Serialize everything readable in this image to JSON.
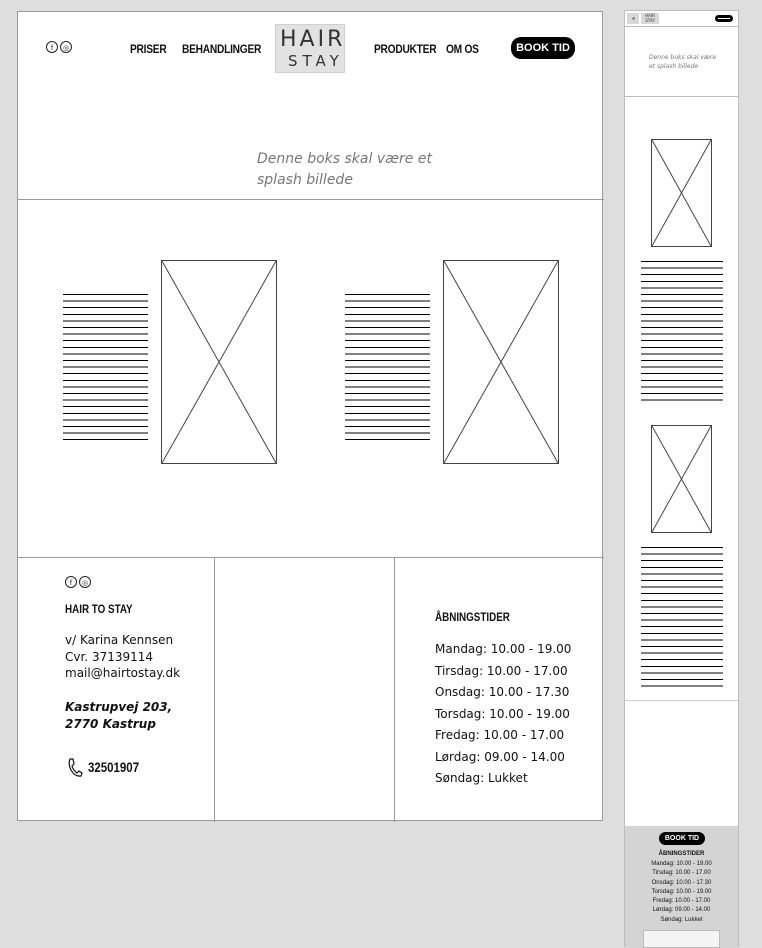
{
  "header": {
    "nav": [
      "PRISER",
      "BEHANDLINGER",
      "PRODUKTER",
      "OM OS"
    ],
    "logo_top": "HAIR",
    "logo_bottom": "STAY",
    "book_label": "BOOK TID",
    "splash_text": "Denne boks skal være et splash billede"
  },
  "footer": {
    "company": "HAIR TO STAY",
    "contact_lines": [
      "v/ Karina Kennsen",
      "Cvr. 37139114",
      "mail@hairtostay.dk"
    ],
    "address_lines": [
      "Kastrupvej 203,",
      "2770 Kastrup"
    ],
    "phone": "32501907",
    "hours_title": "ÅBNINGSTIDER",
    "hours": [
      "Mandag: 10.00 - 19.00",
      "Tirsdag: 10.00 - 17.00",
      "Onsdag: 10.00 - 17.30",
      "Torsdag: 10.00 - 19.00",
      "Fredag: 10.00 - 17.00",
      "Lørdag: 09.00 - 14.00",
      "Søndag: Lukket"
    ]
  },
  "mobile": {
    "logo_text": "HAIR STAY",
    "splash_text": "Denne boks skal være et splash billede",
    "book_label": "BOOK TID",
    "hours_title": "ÅBNINGSTIDER",
    "hours": [
      "Mandag: 10.00 - 19.00",
      "Tirsdag: 10.00 - 17.00",
      "Onsdag: 10.00 - 17.30",
      "Torsdag: 10.00 - 19.00",
      "Fredag: 10.00 - 17.00",
      "Lørdag: 09.00 - 14.00",
      "Søndag: Lukket"
    ]
  },
  "icons": [
    "facebook-icon",
    "instagram-icon",
    "phone-icon",
    "hamburger-menu-icon"
  ]
}
